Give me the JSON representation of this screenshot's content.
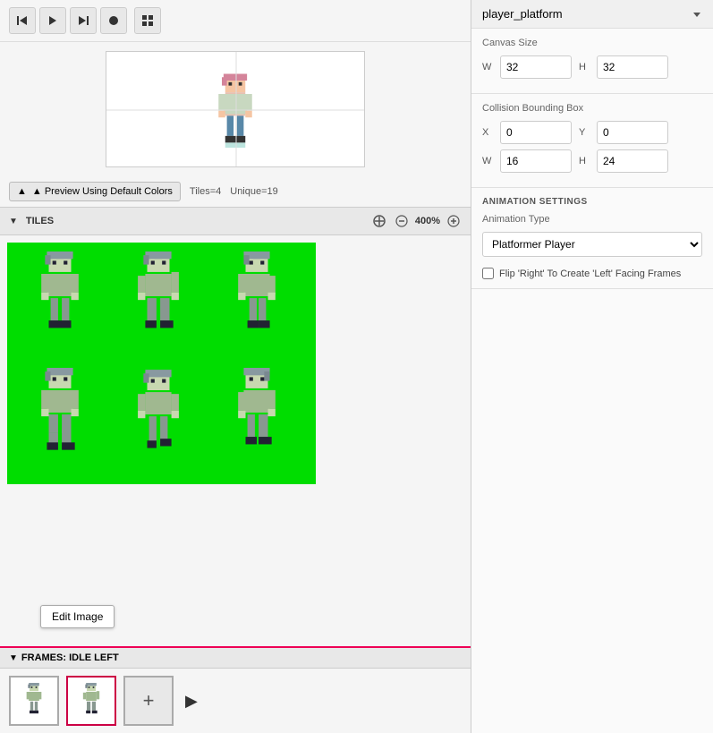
{
  "toolbar": {
    "title": "player_platform",
    "buttons": [
      "skip-back",
      "play",
      "skip-forward",
      "record",
      "grid"
    ]
  },
  "preview": {
    "default_colors_btn": "▲ Preview Using Default Colors",
    "tiles_count": "Tiles=4",
    "unique_count": "Unique=19"
  },
  "tiles_section": {
    "label": "TILES",
    "zoom": "400%"
  },
  "edit_image_btn": "Edit Image",
  "frames_section": {
    "label": "FRAMES: IDLE LEFT"
  },
  "right_panel": {
    "title": "player_platform",
    "canvas_size_label": "Canvas Size",
    "canvas_w": "32",
    "canvas_h": "32",
    "collision_label": "Collision Bounding Box",
    "col_x": "0",
    "col_y": "0",
    "col_w": "16",
    "col_h": "24",
    "anim_settings_label": "ANIMATION SETTINGS",
    "anim_type_label": "Animation Type",
    "anim_type_value": "Platformer Player",
    "flip_label": "Flip 'Right' To Create 'Left' Facing Frames"
  }
}
